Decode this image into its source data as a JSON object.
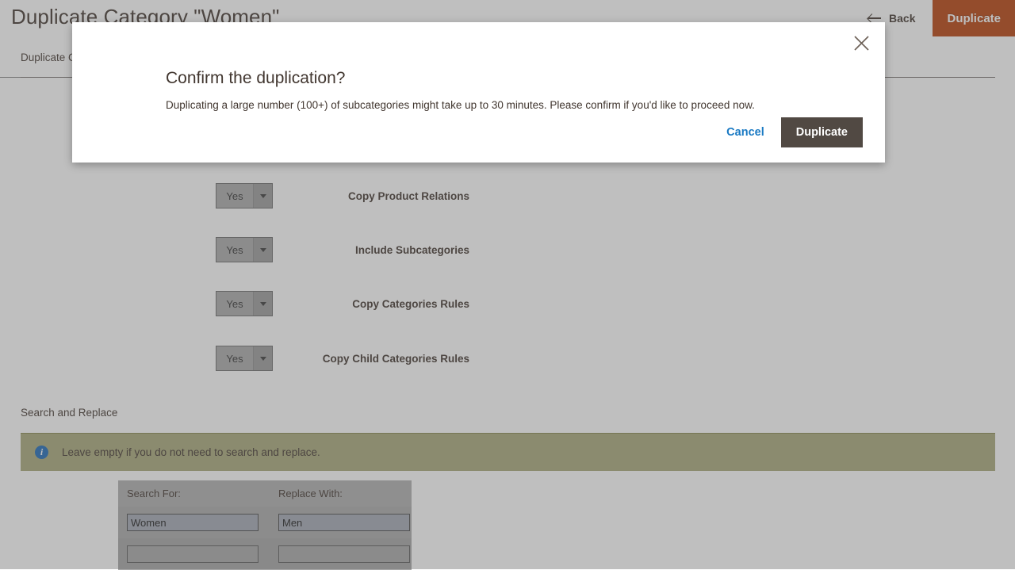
{
  "header": {
    "title": "Duplicate Category \"Women\"",
    "back_label": "Back",
    "duplicate_label": "Duplicate",
    "back_icon": "arrow-left-icon"
  },
  "tabs": [
    {
      "label": "Duplicate C",
      "active": true
    }
  ],
  "form": {
    "fields": [
      {
        "label": "Copy Product Relations",
        "value": "Yes"
      },
      {
        "label": "Include Subcategories",
        "value": "Yes"
      },
      {
        "label": "Copy Categories Rules",
        "value": "Yes"
      },
      {
        "label": "Copy Child Categories Rules",
        "value": "Yes"
      }
    ]
  },
  "search_replace": {
    "section_title": "Search and Replace",
    "notice_icon": "info-icon",
    "notice_text": "Leave empty if you do not need to search and replace.",
    "columns": [
      "Search For:",
      "Replace With:"
    ],
    "rows": [
      {
        "search": "Women",
        "replace": "Men"
      },
      {
        "search": "",
        "replace": ""
      }
    ]
  },
  "modal": {
    "title": "Confirm the duplication?",
    "message": "Duplicating a large number (100+) of subcategories might take up to 30 minutes. Please confirm if you'd like to proceed now.",
    "cancel_label": "Cancel",
    "confirm_label": "Duplicate",
    "close_icon": "close-icon"
  },
  "colors": {
    "orange_accent": "#b8400b",
    "link_blue": "#1979c3",
    "dark_button": "#514943",
    "notice_khaki": "#a8a87a",
    "info_blue": "#1d6ab8"
  }
}
